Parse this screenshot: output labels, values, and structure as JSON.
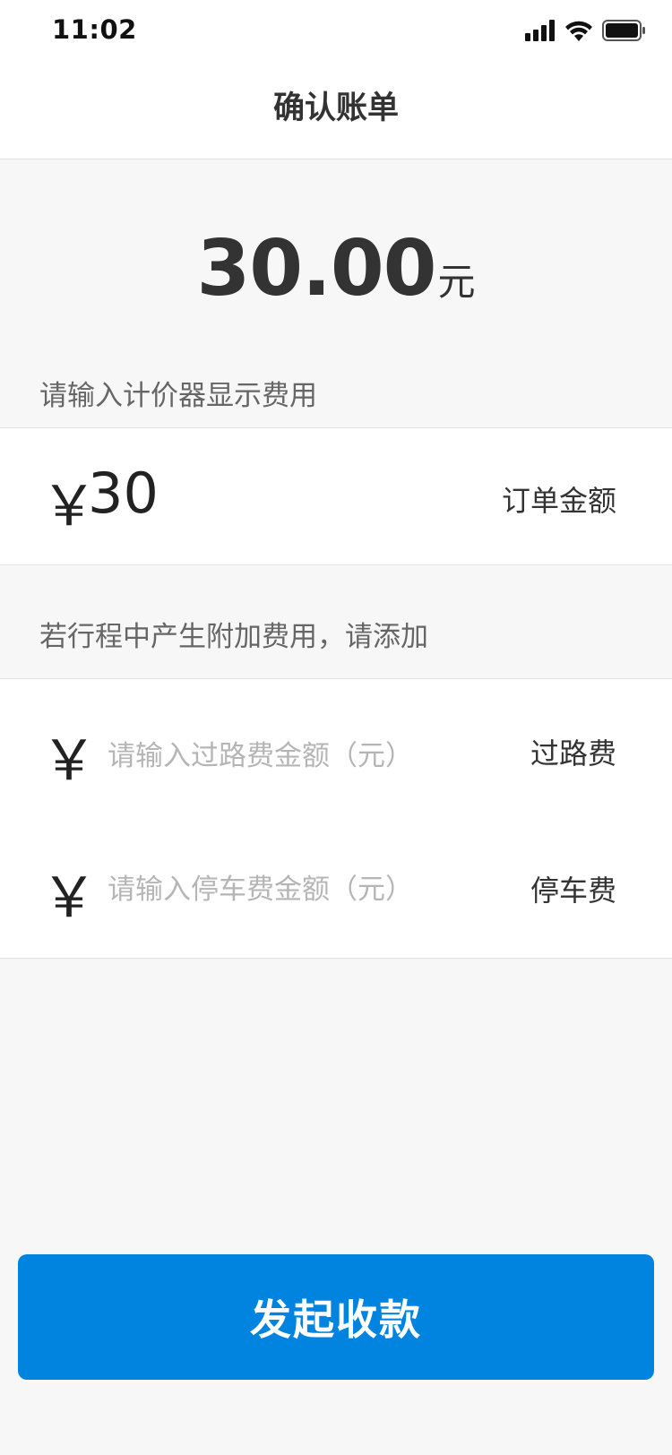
{
  "status_bar": {
    "time": "11:02"
  },
  "nav": {
    "title": "确认账单"
  },
  "amount": {
    "value": "30.00",
    "unit": "元"
  },
  "meter": {
    "tip": "请输入计价器显示费用",
    "currency_symbol": "￥",
    "value": "30",
    "label": "订单金额"
  },
  "extras": {
    "tip": "若行程中产生附加费用，请添加",
    "items": [
      {
        "currency_symbol": "￥",
        "placeholder": "请输入过路费金额（元）",
        "label": "过路费"
      },
      {
        "currency_symbol": "￥",
        "placeholder": "请输入停车费金额（元）",
        "label": "停车费"
      }
    ]
  },
  "submit": {
    "label": "发起收款"
  },
  "colors": {
    "primary": "#0084e0",
    "background": "#f7f7f7"
  },
  "icons": [
    "signal-icon",
    "wifi-icon",
    "battery-icon"
  ]
}
